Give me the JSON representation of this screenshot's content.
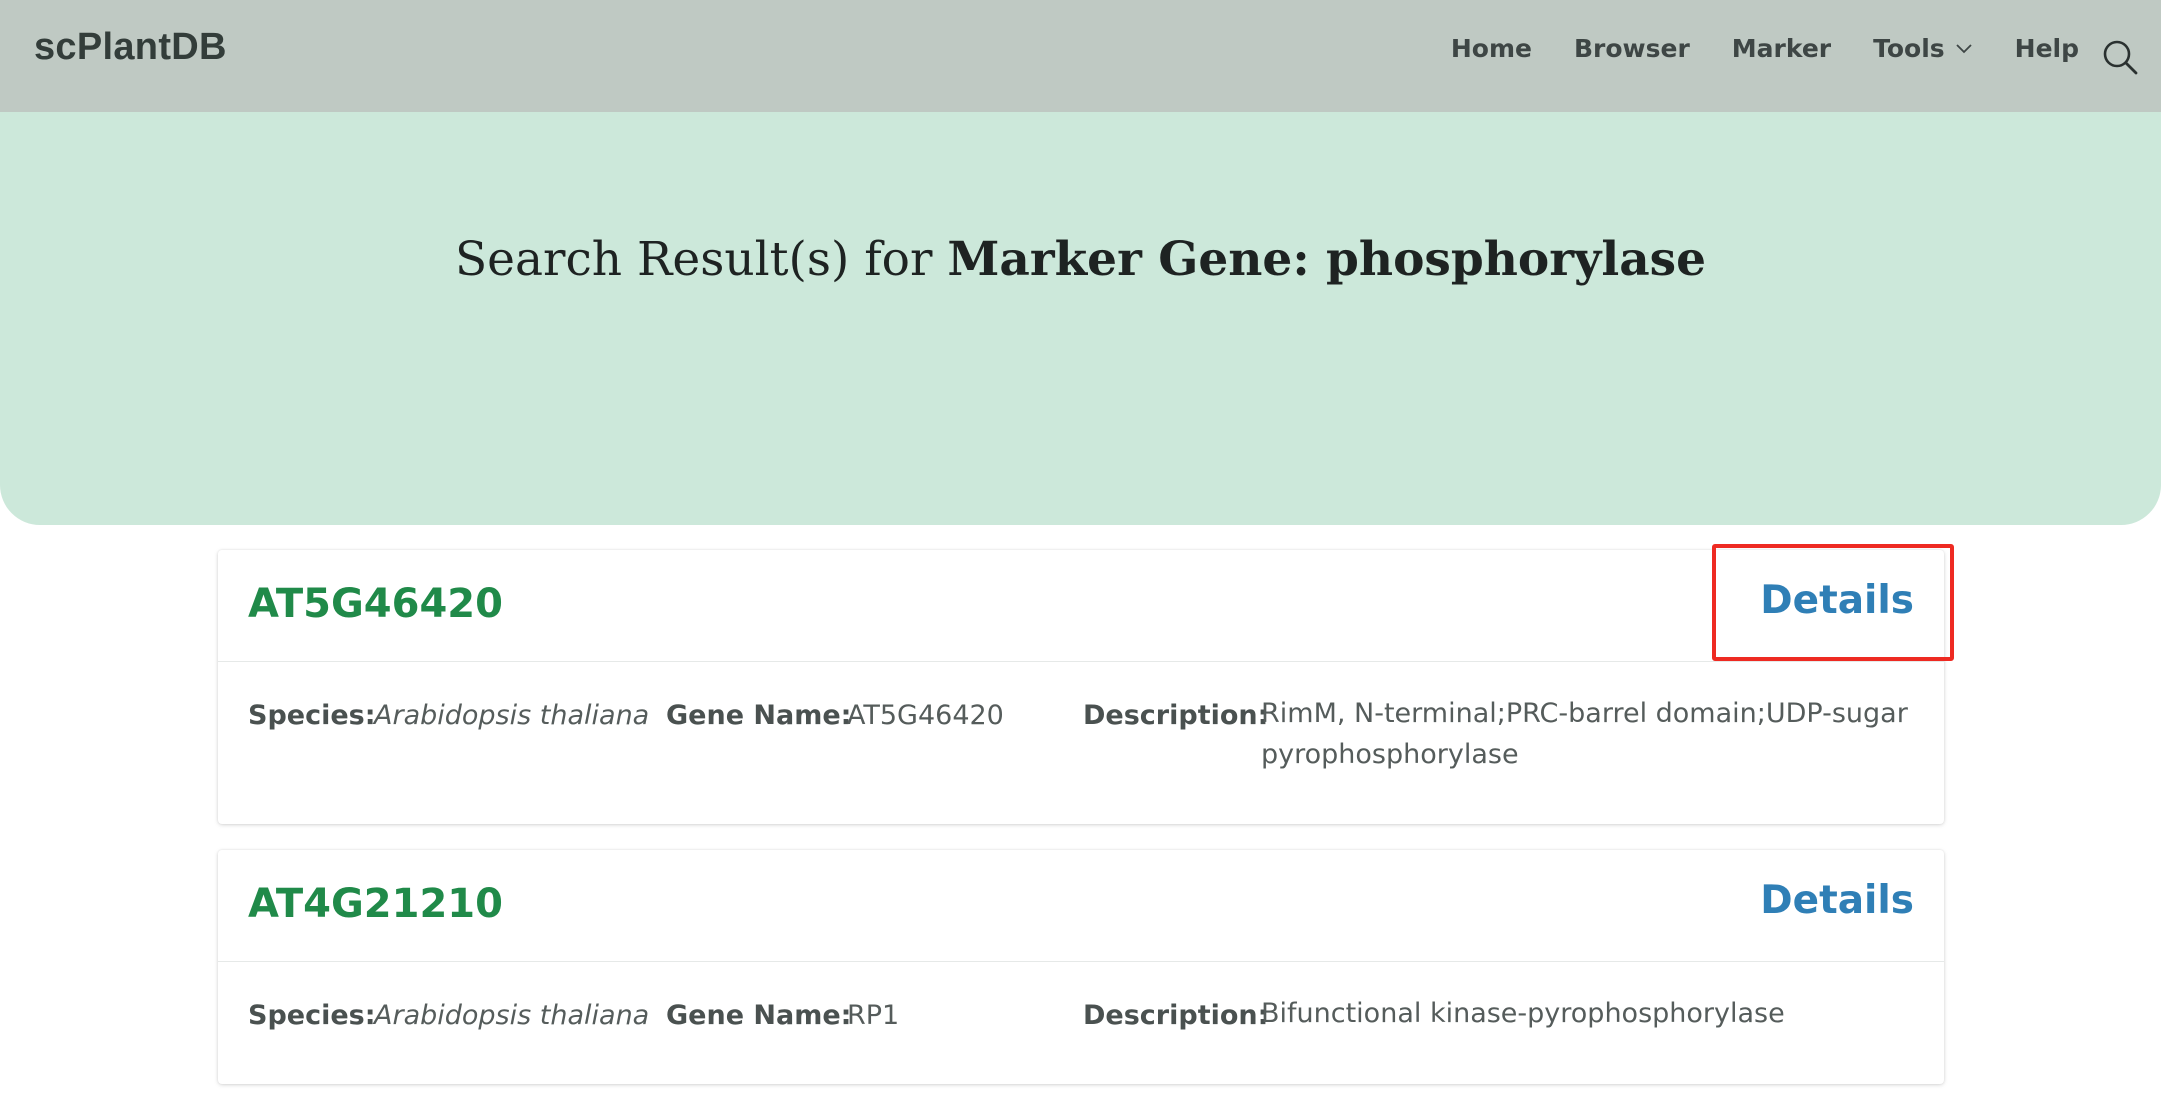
{
  "navbar": {
    "brand": "scPlantDB",
    "items": [
      {
        "label": "Home"
      },
      {
        "label": "Browser"
      },
      {
        "label": "Marker"
      },
      {
        "label": "Tools"
      },
      {
        "label": "Help"
      }
    ],
    "search_icon": "search-icon",
    "tools_dropdown_icon": "chevron-down-icon"
  },
  "hero": {
    "prefix": "Search Result(s) for ",
    "query_label": "Marker Gene: phosphorylase"
  },
  "labels": {
    "species": "Species:",
    "gene_name": "Gene Name:",
    "description": "Description:",
    "details": "Details"
  },
  "results": [
    {
      "gene_id": "AT5G46420",
      "species": "Arabidopsis thaliana",
      "gene_name": "AT5G46420",
      "description": "RimM, N-terminal;PRC-barrel domain;UDP-sugar pyrophosphorylase",
      "highlighted": true
    },
    {
      "gene_id": "AT4G21210",
      "species": "Arabidopsis thaliana",
      "gene_name": "RP1",
      "description": "Bifunctional kinase-pyrophosphorylase",
      "highlighted": false
    }
  ],
  "colors": {
    "navbar_bg": "#bfc9c3",
    "hero_bg": "#cce8da",
    "gene_id": "#208a49",
    "details_link": "#2f7fb6",
    "highlight_box": "#ee2a22"
  }
}
